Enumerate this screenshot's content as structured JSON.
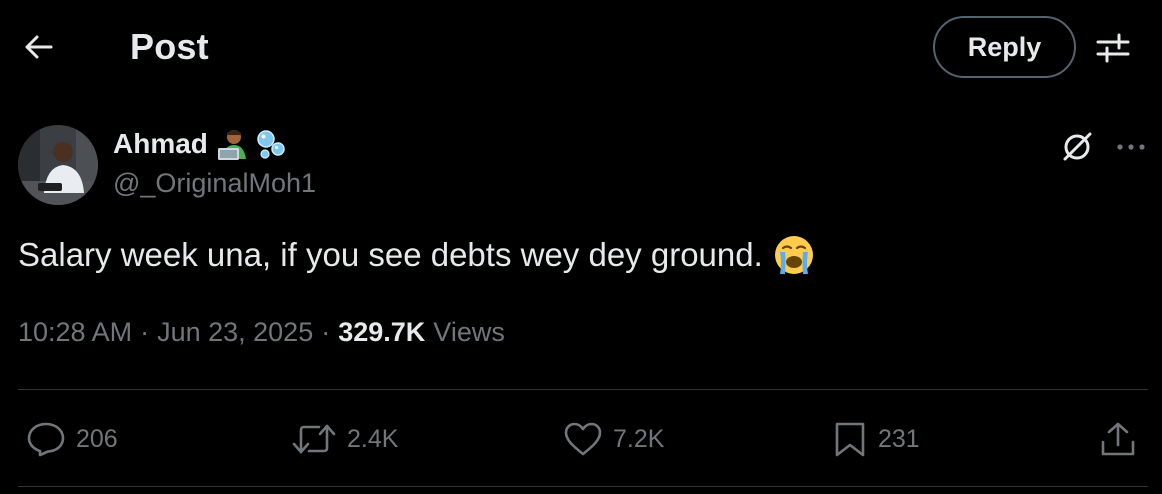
{
  "header": {
    "back_icon": "arrow-left-icon",
    "title": "Post",
    "reply_label": "Reply",
    "filter_icon": "sliders-icon"
  },
  "author": {
    "display_name": "Ahmad",
    "handle": "@_OriginalMoh1",
    "badges": [
      "man-technologist-emoji",
      "bubbles-emoji"
    ]
  },
  "tweet": {
    "text": "Salary week una, if you see debts wey dey ground.",
    "emoji": "loudly-crying-face-emoji"
  },
  "meta": {
    "time": "10:28 AM",
    "separator": "·",
    "date": "Jun 23, 2025",
    "views_count": "329.7K",
    "views_label": "Views"
  },
  "actions": {
    "replies": "206",
    "reposts": "2.4K",
    "likes": "7.2K",
    "bookmarks": "231"
  },
  "colors": {
    "background": "#000000",
    "text_primary": "#e7e9ea",
    "text_secondary": "#71767b",
    "border": "#2f3336",
    "button_border": "#536471"
  }
}
